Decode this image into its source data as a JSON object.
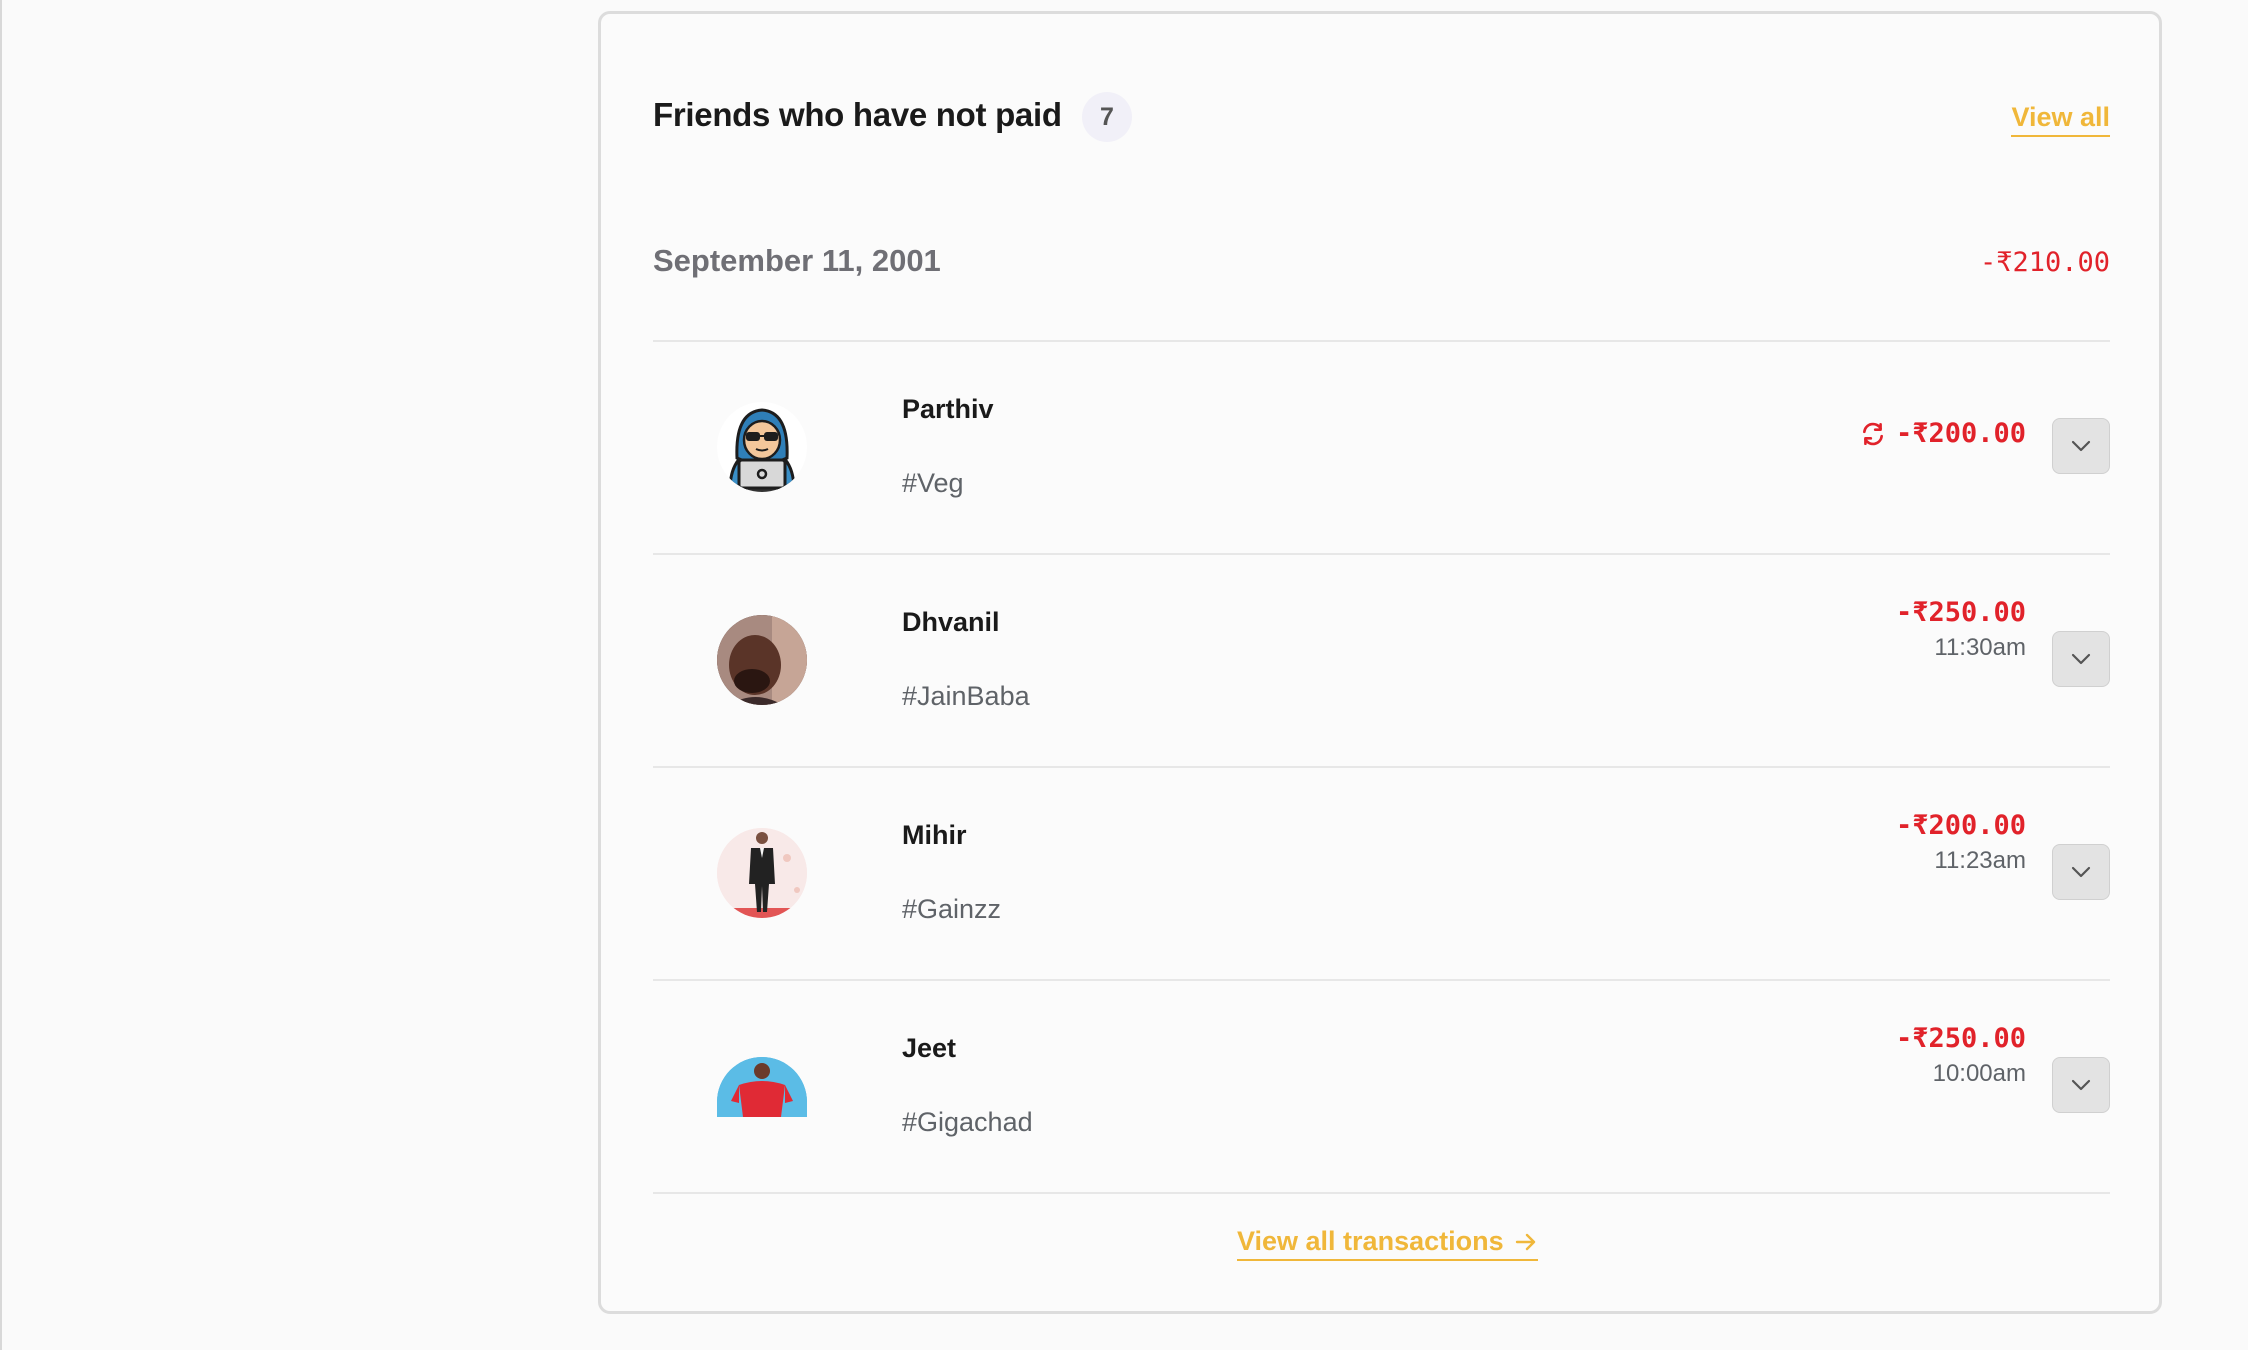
{
  "section": {
    "title": "Friends who have not paid",
    "count": "7",
    "view_all": "View all"
  },
  "group": {
    "date": "September 11, 2001",
    "total": "-₹210.00"
  },
  "rows": [
    {
      "name": "Parthiv",
      "tag": "#Veg",
      "amount": "-₹200.00",
      "time": "",
      "recurring": true,
      "avatar": "hacker-avatar"
    },
    {
      "name": "Dhvanil",
      "tag": "#JainBaba",
      "amount": "-₹250.00",
      "time": "11:30am",
      "recurring": false,
      "avatar": "photo-avatar"
    },
    {
      "name": "Mihir",
      "tag": "#Gainzz",
      "amount": "-₹200.00",
      "time": "11:23am",
      "recurring": false,
      "avatar": "photo-avatar"
    },
    {
      "name": "Jeet",
      "tag": "#Gigachad",
      "amount": "-₹250.00",
      "time": "10:00am",
      "recurring": false,
      "avatar": "photo-avatar"
    }
  ],
  "footer": {
    "view_all_transactions": "View all transactions"
  },
  "colors": {
    "accent": "#f0b73a",
    "negative": "#e1222a",
    "muted": "#6f6f75"
  },
  "icons": [
    "refresh-icon",
    "chevron-down-icon",
    "arrow-right-icon"
  ]
}
